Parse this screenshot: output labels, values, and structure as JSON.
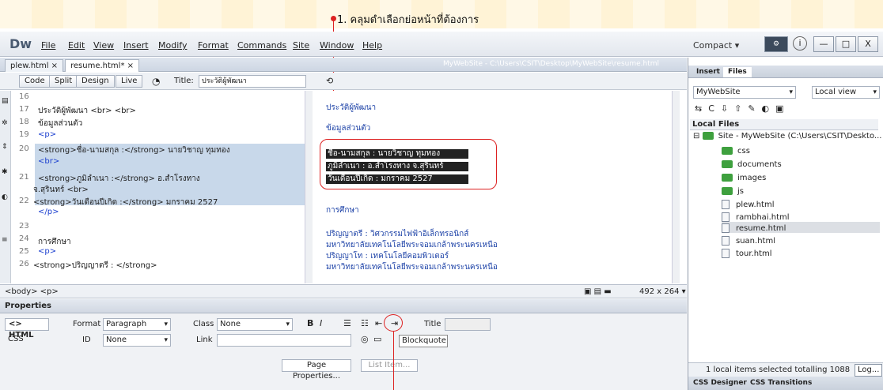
{
  "annotation": {
    "step_text": "1. คลุมดำเลือกย่อหน้าที่ต้องการ"
  },
  "app": {
    "logo": "Dw"
  },
  "menu": [
    "File",
    "Edit",
    "View",
    "Insert",
    "Modify",
    "Format",
    "Commands",
    "Site",
    "Window",
    "Help"
  ],
  "workspace": {
    "label": "Compact ▾"
  },
  "window_buttons": {
    "minimize": "—",
    "maximize": "□",
    "close": "X"
  },
  "doc_tabs": [
    "plew.html ×",
    "resume.html* ×"
  ],
  "doc_path": "MyWebSite - C:\\Users\\CSIT\\Desktop\\MyWebSite\\resume.html",
  "view_buttons": {
    "code": "Code",
    "split": "Split",
    "design": "Design",
    "live": "Live"
  },
  "title_label": "Title:",
  "title_value": "ประวัติผู้พัฒนา",
  "code_lines": [
    {
      "n": "16",
      "html": ""
    },
    {
      "n": "17",
      "html": "ประวัติผู้พัฒนา <br> <br>"
    },
    {
      "n": "18",
      "html": "ข้อมูลส่วนตัว"
    },
    {
      "n": "19",
      "html": "<p>"
    },
    {
      "n": "20",
      "html": "  <strong>ชื่อ-นามสกุล :</strong> นายวิชาญ ทุมทอง"
    },
    {
      "n": "",
      "html": "  <br>"
    },
    {
      "n": "21",
      "html": "  <strong>ภูมิลำเนา :</strong> อ.สำโรงทาง"
    },
    {
      "n": "",
      "html": "จ.สุรินทร์ <br>"
    },
    {
      "n": "22",
      "html": "<strong>วันเดือนปีเกิด :</strong> มกราคม 2527"
    },
    {
      "n": "",
      "html": "</p>"
    },
    {
      "n": "23",
      "html": ""
    },
    {
      "n": "24",
      "html": "  การศึกษา"
    },
    {
      "n": "25",
      "html": "<p>"
    },
    {
      "n": "26",
      "html": "<strong>ปริญญาตรี : </strong>"
    }
  ],
  "design": {
    "heading1": "ประวัติผู้พัฒนา",
    "heading2": "ข้อมูลส่วนตัว",
    "sel1": "ชื่อ-นามสกุล : นายวิชาญ ทุมทอง",
    "sel2": "ภูมิลำเนา : อ.สำโรงทาง จ.สุรินทร์",
    "sel3": "วันเดือนปีเกิด : มกราคม 2527",
    "edu": "การศึกษา",
    "bachelor": "ปริญญาตรี : วิศวกรรมไฟฟ้าอิเล็กทรอนิกส์",
    "uni1": "มหาวิทยาลัยเทคโนโลยีพระจอมเกล้าพระนครเหนือ",
    "master": "ปริญญาโท : เทคโนโลยีคอมพิวเตอร์",
    "uni2": "มหาวิทยาลัยเทคโนโลยีพระจอมเกล้าพระนครเหนือ"
  },
  "status": {
    "tag_path": "<body> <p>",
    "size": "492 x 264 ▾"
  },
  "properties": {
    "header": "Properties",
    "html_btn": "<> HTML",
    "css_btn": "CSS",
    "format_label": "Format",
    "format_value": "Paragraph",
    "class_label": "Class",
    "class_value": "None",
    "id_label": "ID",
    "id_value": "None",
    "link_label": "Link",
    "title_label": "Title",
    "tooltip": "Blockquote",
    "page_properties": "Page Properties...",
    "list_item": "List Item..."
  },
  "right_panel": {
    "tabs": [
      "Insert",
      "Files"
    ],
    "site": "MyWebSite",
    "view": "Local view",
    "local_files": "Local Files",
    "root": "Site - MyWebSite (C:\\Users\\CSIT\\Deskto...",
    "items": [
      "css",
      "documents",
      "images",
      "js",
      "plew.html",
      "rambhai.html",
      "resume.html",
      "suan.html",
      "tour.html"
    ],
    "status": "1 local items selected totalling 1088",
    "log": "Log...",
    "bottom_tabs": [
      "CSS Designer",
      "CSS Transitions"
    ]
  }
}
